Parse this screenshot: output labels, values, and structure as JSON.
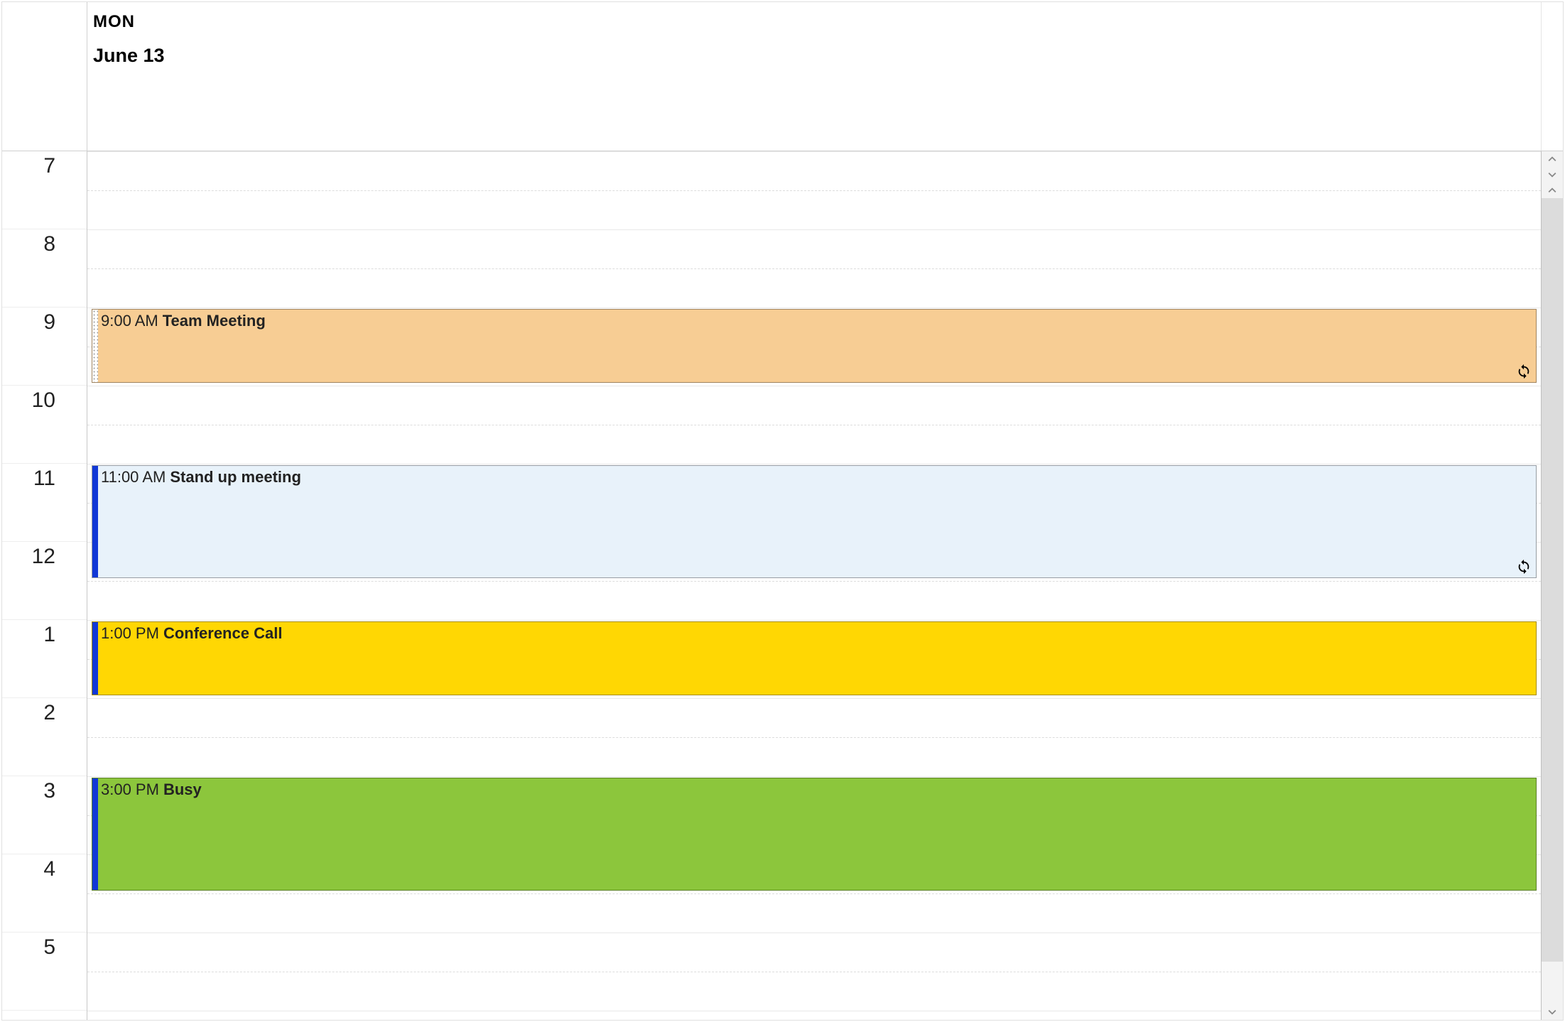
{
  "header": {
    "dayOfWeek": "MON",
    "date": "June 13"
  },
  "hours": [
    "7",
    "8",
    "9",
    "10",
    "11",
    "12",
    "1",
    "2",
    "3",
    "4",
    "5"
  ],
  "hourHeight": 110,
  "events": [
    {
      "time": "9:00 AM",
      "title": "Team Meeting",
      "startSlot": 2,
      "durationSlots": 1,
      "bg": "#f7cd94",
      "barColor": "#ffffff",
      "barPattern": true,
      "recurring": true
    },
    {
      "time": "11:00 AM",
      "title": "Stand up meeting",
      "startSlot": 4,
      "durationSlots": 1.5,
      "bg": "#e8f2fa",
      "barColor": "#1138d6",
      "barPattern": false,
      "recurring": true
    },
    {
      "time": "1:00 PM",
      "title": "Conference Call",
      "startSlot": 6,
      "durationSlots": 1,
      "bg": "#ffd703",
      "barColor": "#1138d6",
      "barPattern": false,
      "recurring": false
    },
    {
      "time": "3:00 PM",
      "title": "Busy",
      "startSlot": 8,
      "durationSlots": 1.5,
      "bg": "#8cc63c",
      "barColor": "#1138d6",
      "barPattern": false,
      "recurring": false
    }
  ]
}
